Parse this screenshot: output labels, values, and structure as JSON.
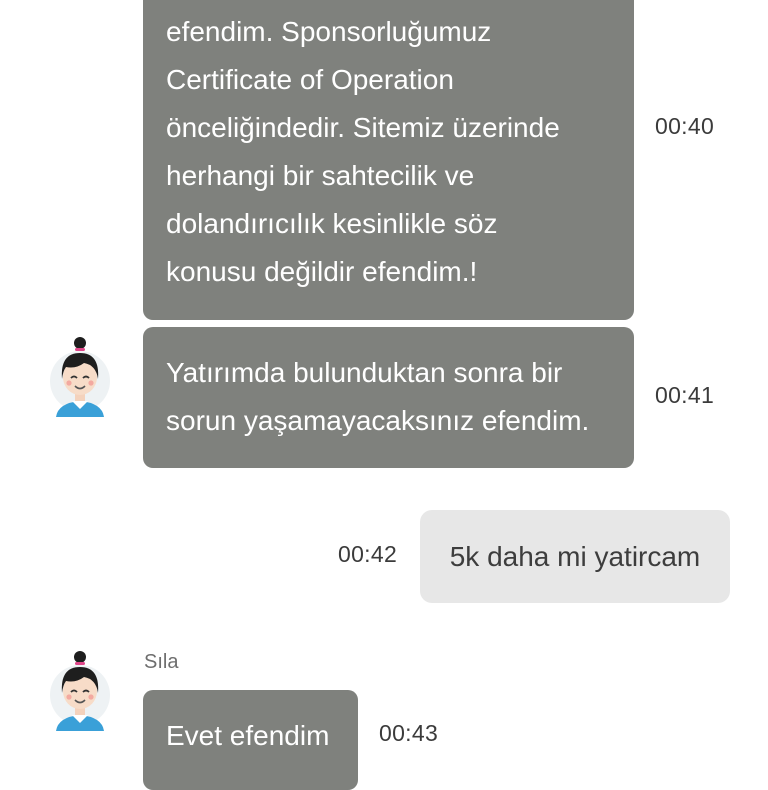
{
  "messages": [
    {
      "from": "agent",
      "lines": [
        "efendim. Sponsorluğumuz",
        "Certificate of Operation",
        "önceliğindedir. Sitemiz üzerinde",
        "herhangi bir sahtecilik ve",
        "dolandırıcılık kesinlikle söz",
        "konusu değildir efendim.!"
      ],
      "time": "00:40"
    },
    {
      "from": "agent",
      "lines": [
        "Yatırımda bulunduktan sonra bir",
        "sorun yaşamayacaksınız efendim."
      ],
      "time": "00:41"
    },
    {
      "from": "user",
      "text": "5k daha mi yatircam",
      "time": "00:42"
    },
    {
      "from": "agent",
      "sender": "Sıla",
      "lines": [
        "Evet efendim"
      ],
      "time": "00:43"
    }
  ],
  "colors": {
    "agent_bubble": "#7f817d",
    "user_bubble": "#e7e7e7",
    "avatar_shirt": "#3aa0d8",
    "avatar_hair": "#1e1e1e"
  },
  "icons": {
    "agent_avatar": "support-agent-avatar-icon"
  }
}
